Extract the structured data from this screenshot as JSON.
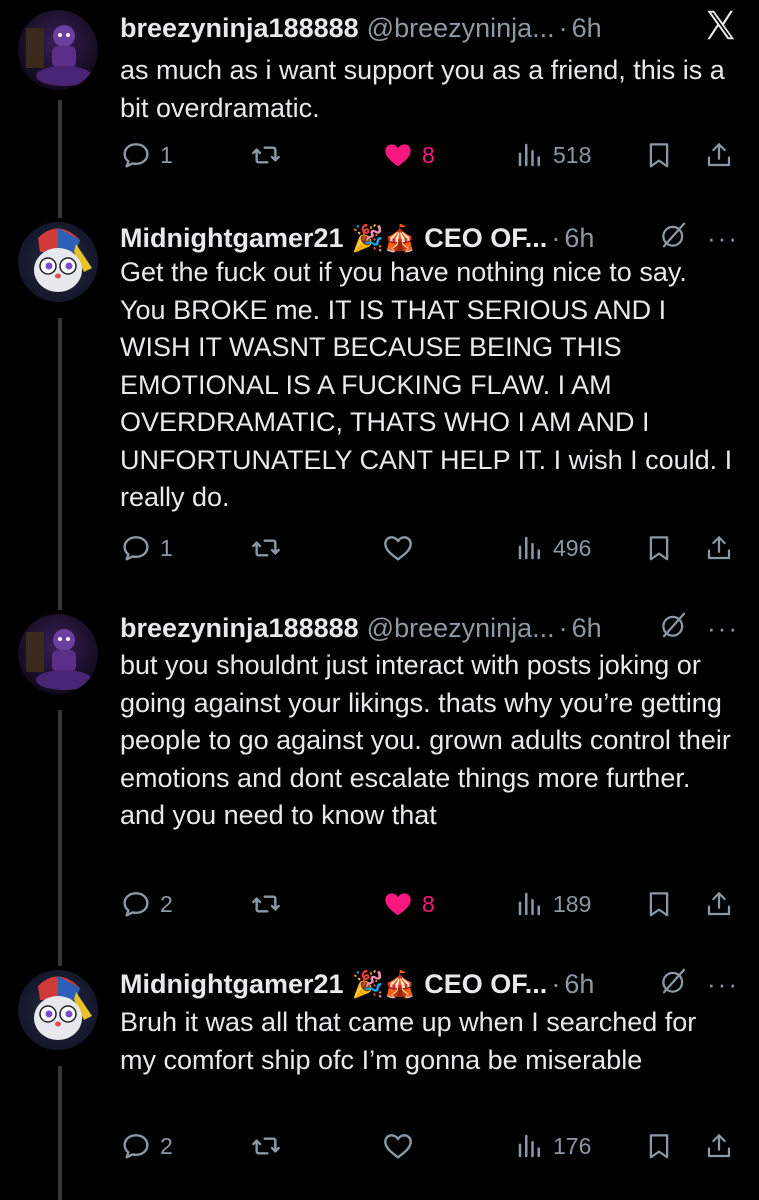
{
  "tweets": [
    {
      "name": "breezyninja188888",
      "handle": "@breezyninja...",
      "time": "6h",
      "text": "as much as i want support you as a friend, this is a bit overdramatic.",
      "replies": "1",
      "likes": "8",
      "liked": true,
      "views": "518",
      "top_right_icon": "x-logo-icon"
    },
    {
      "name": "Midnightgamer21",
      "badges": "🎉🎪",
      "bio_title": "CEO OF...",
      "time": "6h",
      "text": "Get the fuck out if you have nothing nice to say. You BROKE me. IT IS THAT SERIOUS AND I WISH IT WASNT BECAUSE BEING THIS EMOTIONAL IS A FUCKING FLAW. I AM OVERDRAMATIC, THATS WHO I AM AND I UNFORTUNATELY CANT HELP IT. I wish I could. I really do.",
      "replies": "1",
      "likes": "",
      "liked": false,
      "views": "496"
    },
    {
      "name": "breezyninja188888",
      "handle": "@breezyninja...",
      "time": "6h",
      "text": "but you shouldnt just interact with posts joking or going against your likings. thats why you’re getting people to go against you. grown adults control their emotions and dont escalate things more further. and you need to know that",
      "replies": "2",
      "likes": "8",
      "liked": true,
      "views": "189"
    },
    {
      "name": "Midnightgamer21",
      "badges": "🎉🎪",
      "bio_title": "CEO OF...",
      "time": "6h",
      "text": "Bruh it was all that came up when I searched for my comfort ship ofc I’m gonna be miserable",
      "replies": "2",
      "likes": "",
      "liked": false,
      "views": "176"
    }
  ],
  "dot": "·",
  "more": "···",
  "colors": {
    "background": "#000000",
    "text": "#e7e9ea",
    "muted": "#8b98a5",
    "like": "#f91880",
    "thread": "#333639"
  }
}
